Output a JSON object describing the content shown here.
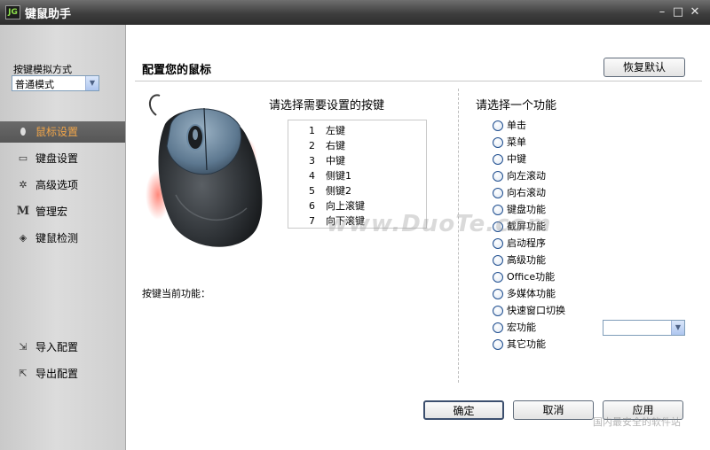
{
  "window": {
    "title": "键鼠助手",
    "app_icon_text": "JG"
  },
  "sidebar": {
    "mode_label": "按键模拟方式",
    "mode_value": "普通模式",
    "nav": [
      {
        "label": "鼠标设置",
        "icon": "mouse-icon",
        "active": true
      },
      {
        "label": "键盘设置",
        "icon": "keyboard-icon",
        "active": false
      },
      {
        "label": "高级选项",
        "icon": "gear-icon",
        "active": false
      },
      {
        "label": "管理宏",
        "icon": "macro-m-icon",
        "active": false
      },
      {
        "label": "键鼠检测",
        "icon": "detect-icon",
        "active": false
      }
    ],
    "import_label": "导入配置",
    "export_label": "导出配置"
  },
  "main": {
    "heading": "配置您的鼠标",
    "restore_label": "恢复默认",
    "keys_title": "请选择需要设置的按键",
    "keys": [
      {
        "num": "1",
        "name": "左键"
      },
      {
        "num": "2",
        "name": "右键"
      },
      {
        "num": "3",
        "name": "中键"
      },
      {
        "num": "4",
        "name": "侧键1"
      },
      {
        "num": "5",
        "name": "侧键2"
      },
      {
        "num": "6",
        "name": "向上滚键"
      },
      {
        "num": "7",
        "name": "向下滚键"
      }
    ],
    "current_label": "按键当前功能：",
    "func_title": "请选择一个功能",
    "functions": [
      "单击",
      "菜单",
      "中键",
      "向左滚动",
      "向右滚动",
      "键盘功能",
      "截屏功能",
      "启动程序",
      "高级功能",
      "Office功能",
      "多媒体功能",
      "快速窗口切换",
      "宏功能",
      "其它功能"
    ],
    "ok_label": "确定",
    "cancel_label": "取消",
    "apply_label": "应用",
    "watermark": "www.DuoTe.com",
    "corner_watermark": "国内最安全的软件站"
  },
  "colors": {
    "active_nav_text": "#f0a54a",
    "sidebar_bg": "#d4d4d4",
    "title_bar": "#3e3e3e"
  }
}
